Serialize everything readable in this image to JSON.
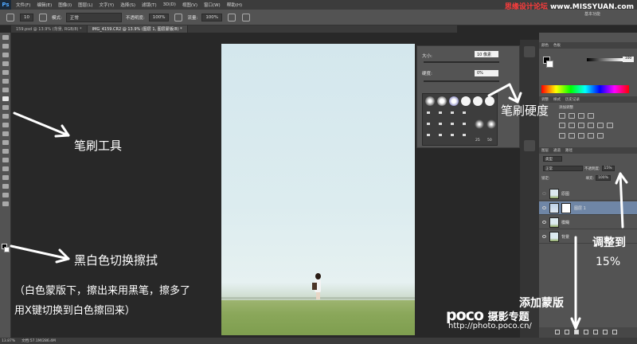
{
  "app": {
    "logo": "Ps",
    "menu": [
      "文件(F)",
      "编辑(E)",
      "图像(I)",
      "图层(L)",
      "文字(Y)",
      "选择(S)",
      "滤镜(T)",
      "3D(D)",
      "视图(V)",
      "窗口(W)",
      "帮助(H)"
    ],
    "workspace": "基本功能"
  },
  "watermark": {
    "text": "思缘设计论坛",
    "url": "www.MISSYUAN.com"
  },
  "options_bar": {
    "brush_size": "10",
    "mode_label": "模式:",
    "mode_value": "正常",
    "opacity_label": "不透明度:",
    "opacity_value": "100%",
    "flow_label": "流量:",
    "flow_value": "100%"
  },
  "tabs": [
    {
      "label": "159.psd @ 13.9% (背景, RGB/8) *",
      "active": false
    },
    {
      "label": "IMG_4159.CR2 @ 13.9% (图层 1, 图层蒙版/8) *",
      "active": true
    }
  ],
  "brush_panel": {
    "size_label": "大小:",
    "size_value": "10 像素",
    "hardness_label": "硬度:",
    "hardness_value": "0%",
    "preset_numbers": [
      "25",
      "50"
    ]
  },
  "right_panels": {
    "color_tabs": [
      "颜色",
      "色板"
    ],
    "k_value": "100",
    "adjust_tabs": [
      "调整",
      "样式",
      "历史记录"
    ],
    "adjust_title": "添加调整",
    "layers_tabs": [
      "图层",
      "通道",
      "路径"
    ],
    "kind_label": "类型",
    "blend_mode": "正常",
    "opacity_label": "不透明度:",
    "opacity_value": "15%",
    "lock_label": "锁定:",
    "fill_label": "填充:",
    "fill_value": "100%",
    "layers": [
      {
        "name": "原图",
        "selected": false,
        "mask": false
      },
      {
        "name": "图层 1",
        "selected": true,
        "mask": true
      },
      {
        "name": "模糊",
        "selected": false,
        "mask": false
      },
      {
        "name": "背景",
        "selected": false,
        "mask": false
      }
    ]
  },
  "status": {
    "zoom": "13.87%",
    "doc": "文档:57.1M/286.4M"
  },
  "annotations": {
    "brush_tool": "笔刷工具",
    "brush_hardness": "笔刷硬度",
    "bw_switch": "黑白色切换擦拭",
    "note_line1": "（白色蒙版下，擦出来用黑笔，擦多了",
    "note_line2": "用X键切换到白色擦回来）",
    "adjust_to": "调整到",
    "percent": "15%",
    "add_mask": "添加蒙版",
    "poco_brand": "poco",
    "poco_sub": "摄影专题",
    "poco_url": "http://photo.poco.cn/"
  },
  "colors": {
    "app_bg": "#282828",
    "panel": "#535353",
    "selected_layer": "#6f86a6",
    "watermark_red": "#ff3c3c"
  }
}
